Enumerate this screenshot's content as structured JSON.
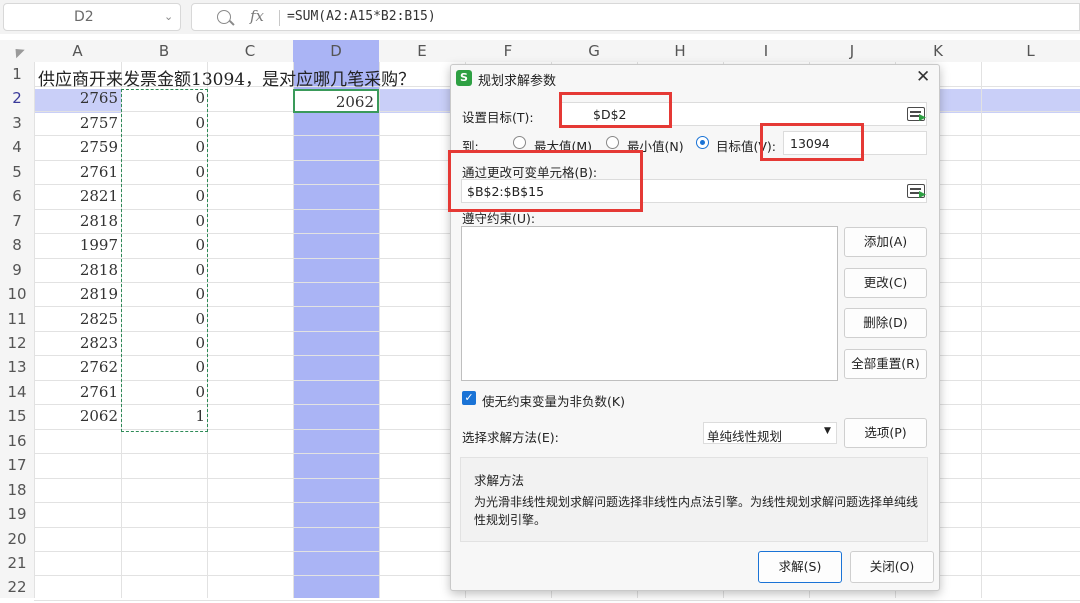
{
  "formula_bar": {
    "name_box": "D2",
    "formula": "=SUM(A2:A15*B2:B15)"
  },
  "sheet": {
    "columns": [
      "A",
      "B",
      "C",
      "D",
      "E",
      "F",
      "G",
      "H",
      "I",
      "J",
      "K",
      "L"
    ],
    "rows": [
      "1",
      "2",
      "3",
      "4",
      "5",
      "6",
      "7",
      "8",
      "9",
      "10",
      "11",
      "12",
      "13",
      "14",
      "15",
      "16",
      "17",
      "18",
      "19",
      "20",
      "21",
      "22"
    ],
    "row1_text": "供应商开来发票金额13094，是对应哪几笔采购？",
    "col_a": [
      "2765",
      "2757",
      "2759",
      "2761",
      "2821",
      "2818",
      "1997",
      "2818",
      "2819",
      "2825",
      "2823",
      "2762",
      "2761",
      "2062"
    ],
    "col_b": [
      "0",
      "0",
      "0",
      "0",
      "0",
      "0",
      "0",
      "0",
      "0",
      "0",
      "0",
      "0",
      "0",
      "1"
    ],
    "d2": "2062",
    "colors": {
      "selection": "#aab4f5",
      "row_highlight": "#c9cff8",
      "accent_red": "#e53935",
      "dashed": "#2e8b57"
    }
  },
  "dialog": {
    "title": "规划求解参数",
    "app_badge": "S",
    "set_target_label": "设置目标(T):",
    "set_target_value": "$D$2",
    "to_label": "到:",
    "opt_max": "最大值(M)",
    "opt_min": "最小值(N)",
    "opt_value": "目标值(V):",
    "target_value": "13094",
    "changing_label": "通过更改可变单元格(B):",
    "changing_value": "$B$2:$B$15",
    "constraints_label": "遵守约束(U):",
    "btn_add": "添加(A)",
    "btn_change": "更改(C)",
    "btn_delete": "删除(D)",
    "btn_reset": "全部重置(R)",
    "nonneg_label": "使无约束变量为非负数(K)",
    "method_label": "选择求解方法(E):",
    "method_value": "单纯线性规划",
    "btn_options": "选项(P)",
    "group_title": "求解方法",
    "group_desc": "为光滑非线性规划求解问题选择非线性内点法引擎。为线性规划求解问题选择单纯线性规划引擎。",
    "btn_solve": "求解(S)",
    "btn_close": "关闭(O)"
  }
}
